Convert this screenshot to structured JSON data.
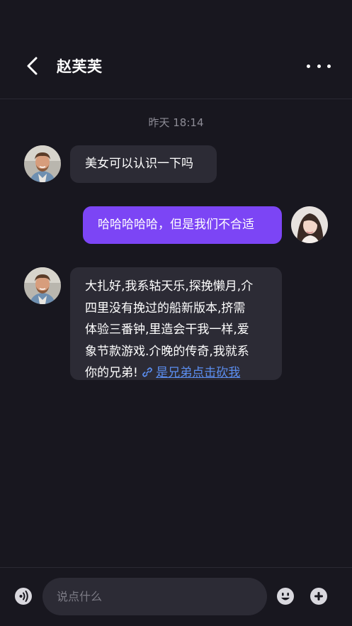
{
  "header": {
    "title": "赵芙芙"
  },
  "messages": {
    "timestamp": "昨天 18:14",
    "m1": {
      "text": "美女可以认识一下吗"
    },
    "m2": {
      "text": "哈哈哈哈哈，但是我们不合适"
    },
    "m3": {
      "lines": [
        "大扎好,我系轱天乐,探挽懒月,介",
        "四里没有挽过的船新版本,挤需",
        "体验三番钟,里造会干我一样,爱",
        "象节款游戏.介晚的传奇,我就系"
      ],
      "last_line_text": "你的兄弟!",
      "link_text": "是兄弟点击砍我"
    }
  },
  "input": {
    "placeholder": "说点什么"
  },
  "colors": {
    "background": "#18171f",
    "incoming_bubble": "#2c2b35",
    "outgoing_bubble": "#7c45f5",
    "link": "#5b8ef0"
  },
  "icons": {
    "back": "chevron-left-icon",
    "more": "more-dots-icon",
    "voice": "voice-icon",
    "emoji": "emoji-icon",
    "plus": "plus-icon",
    "link": "link-icon"
  }
}
